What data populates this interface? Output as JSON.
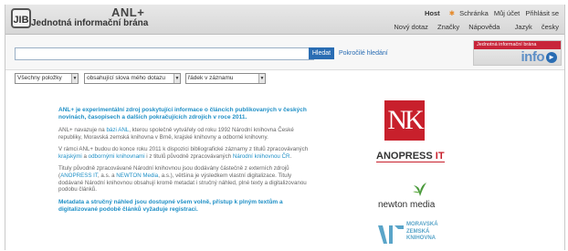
{
  "header": {
    "logo_mark": "JIB",
    "title": "ANL+",
    "subtitle": "Jednotná informační brána",
    "top_links": {
      "host": "Host",
      "cart": "Schránka",
      "account": "Můj účet",
      "login": "Přihlásit se"
    },
    "nav_links": [
      "Nový dotaz",
      "Značky",
      "Nápověda",
      "Jazyk",
      "česky"
    ]
  },
  "search": {
    "value": "",
    "button_label": "Hledat",
    "advanced_link": "Pokročilé hledání"
  },
  "promo": {
    "top_text": "Jednotná informační brána",
    "big_text": "info",
    "arrow": "►"
  },
  "filters": [
    {
      "selected": "Všechny položky"
    },
    {
      "selected": "obsahující slova mého dotazu"
    },
    {
      "selected": "řádek v záznamu"
    }
  ],
  "content": {
    "lead": "ANL+ je experimentální zdroj poskytující informace o článcích publikovaných v českých novinách, časopisech a dalších pokračujících zdrojích v roce 2011.",
    "p1_a": "ANL+ navazuje na ",
    "p1_link": "bázi ANL",
    "p1_b": ", kterou společně vytvářely od roku 1992 Národní knihovna České republiky, Moravská zemská knihovna v Brně, krajské knihovny a odborné knihovny.",
    "p2_a": "V rámci ANL+ budou do konce roku 2011 k dispozici bibliografické záznamy z titulů zpracovávaných ",
    "p2_link1": "krajskými",
    "p2_b": " a ",
    "p2_link2": "odbornými knihovnami",
    "p2_c": " i z titulů původně zpracovávaných ",
    "p2_link3": "Národní knihovnou ČR",
    "p2_d": ".",
    "p3_a": "Tituly původně zpracovávané Národní knihovnou jsou dodávány částečně z externích zdrojů (",
    "p3_link1": "ANOPRESS IT",
    "p3_b": ", a.s. a ",
    "p3_link2": "NEWTON Media",
    "p3_c": ", a.s.), většina je výsledkem vlastní digitalizace. Tituly dodávané Národní knihovnou obsahují kromě metadat i stručný náhled, plné texty a digitalizovanou podobu článků.",
    "outro": "Metadata a stručný náhled jsou dostupné všem volně, přístup k plným textům a digitalizované podobě článků vyžaduje registraci."
  },
  "partners": {
    "nk": "NK",
    "anopress_a": "ANOPRESS",
    "anopress_b": " IT",
    "newton": "newton media",
    "mzk_lines": [
      "MORAVSKÁ",
      "ZEMSKÁ",
      "KNIHOVNA"
    ]
  },
  "colors": {
    "accent_blue": "#1e8fc6",
    "button_blue": "#2a6db3",
    "brand_red": "#c8202c",
    "header_gray": "#dcdcdc"
  }
}
